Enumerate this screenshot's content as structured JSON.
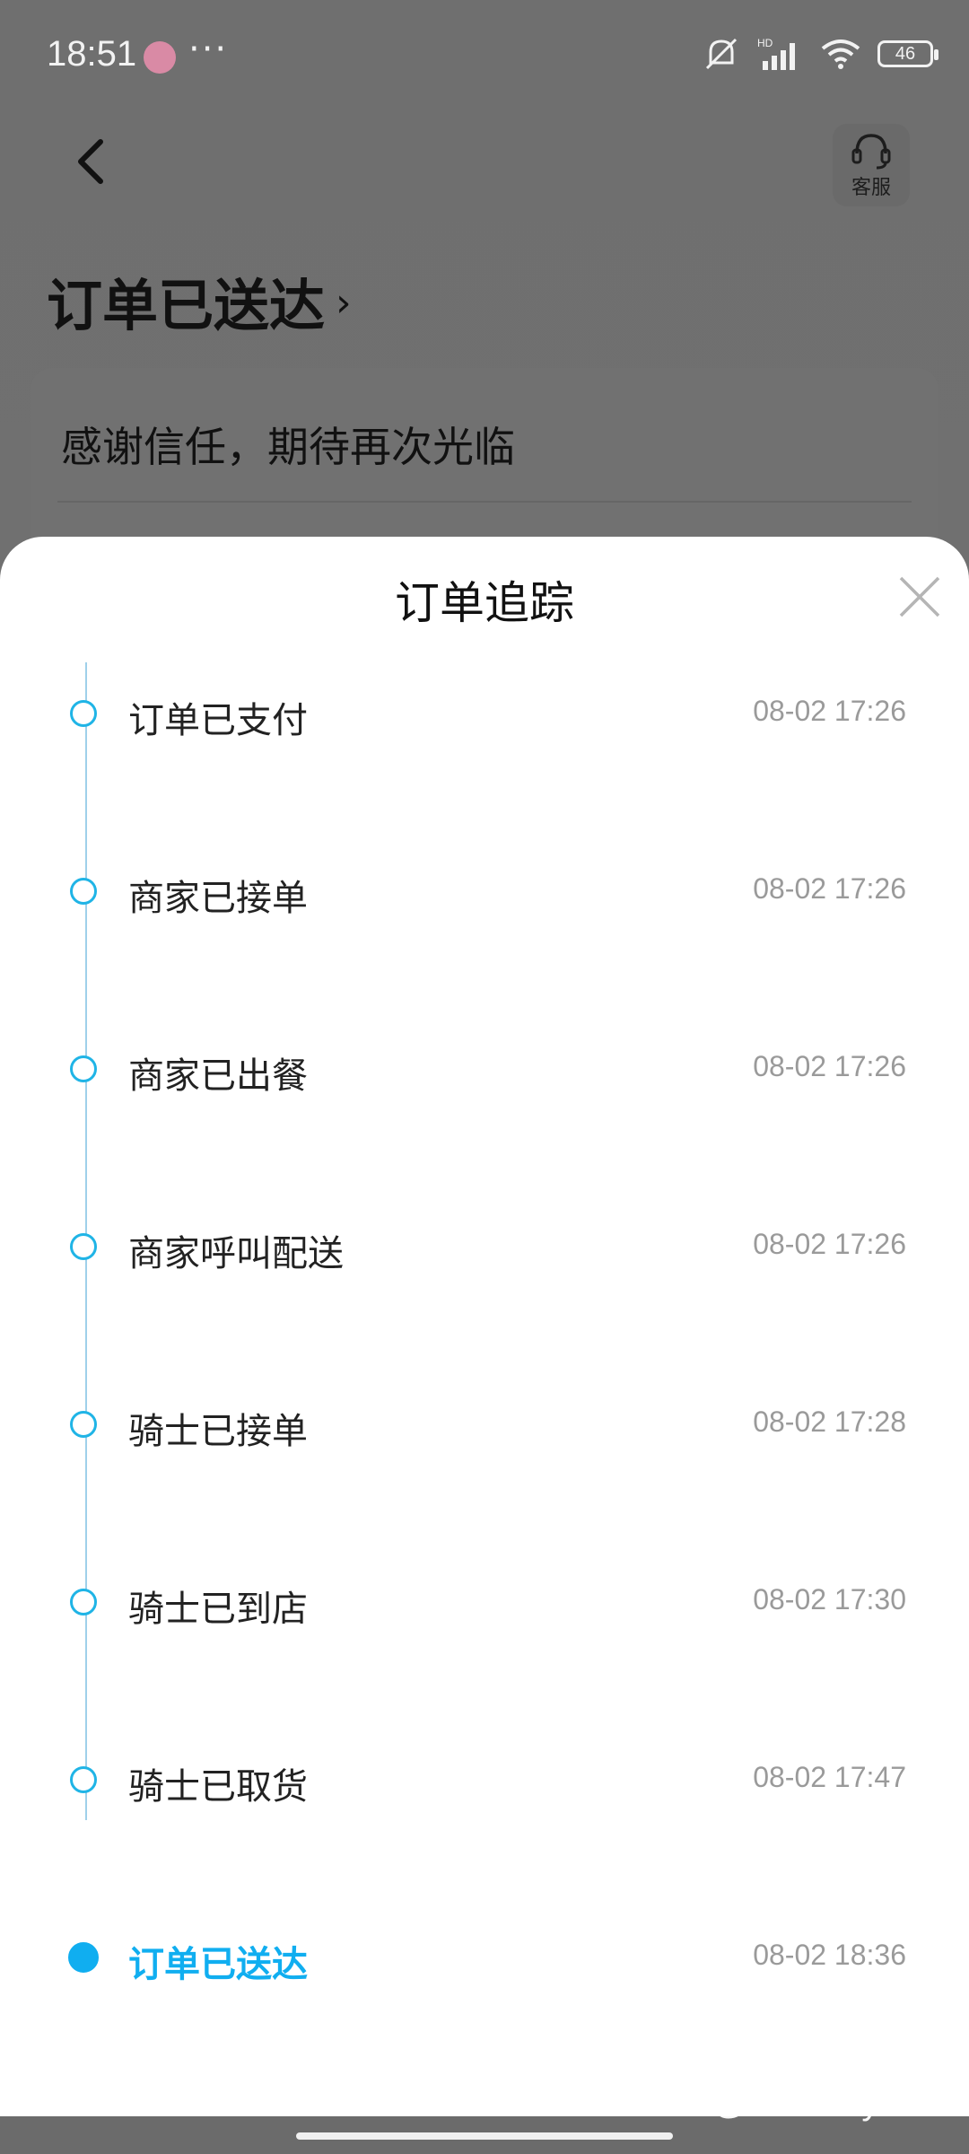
{
  "status_bar": {
    "time": "18:51",
    "more": "···",
    "battery": "46",
    "icons": [
      "app-icon",
      "mute-icon",
      "signal-icon",
      "wifi-icon",
      "battery-icon"
    ]
  },
  "header": {
    "service_label": "客服",
    "order_title": "订单已送达",
    "chevron": "›"
  },
  "card": {
    "message": "感谢信任，期待再次光临"
  },
  "sheet": {
    "title": "订单追踪",
    "steps": [
      {
        "label": "订单已支付",
        "time": "08-02 17:26"
      },
      {
        "label": "商家已接单",
        "time": "08-02 17:26"
      },
      {
        "label": "商家已出餐",
        "time": "08-02 17:26"
      },
      {
        "label": "商家呼叫配送",
        "time": "08-02 17:26"
      },
      {
        "label": "骑士已接单",
        "time": "08-02 17:28"
      },
      {
        "label": "骑士已到店",
        "time": "08-02 17:30"
      },
      {
        "label": "骑士已取货",
        "time": "08-02 17:47"
      },
      {
        "label": "订单已送达",
        "time": "08-02 18:36"
      }
    ]
  },
  "watermark": "COLG @saberlilysam",
  "colors": {
    "accent": "#10aef0",
    "timeline": "#9fd0ea",
    "time_text": "#9a9a9a"
  }
}
